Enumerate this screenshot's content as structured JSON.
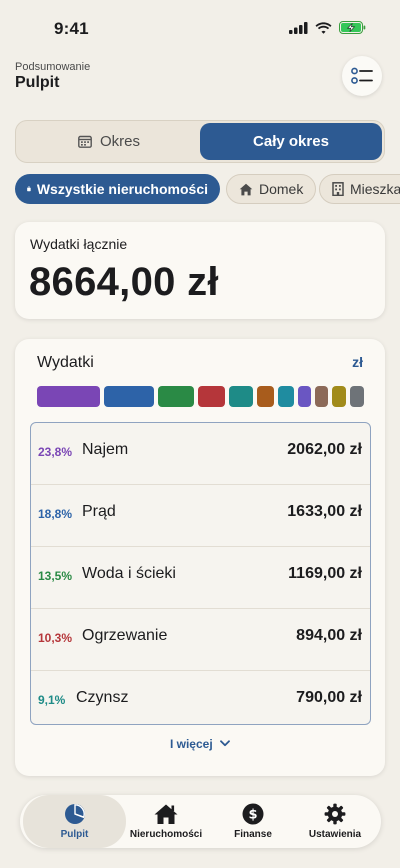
{
  "status_bar": {
    "time": "9:41"
  },
  "header": {
    "subtitle": "Podsumowanie",
    "title": "Pulpit"
  },
  "period_toggle": {
    "options": [
      "Okres",
      "Cały okres"
    ],
    "selected": "Cały okres"
  },
  "property_filter": {
    "chips": [
      "Wszystkie nieruchomości",
      "Domek",
      "Mieszkanie"
    ],
    "selected": "Wszystkie nieruchomości"
  },
  "total_card": {
    "label": "Wydatki łącznie",
    "amount": "8664,00 zł"
  },
  "expenses": {
    "title": "Wydatki",
    "currency": "zł",
    "segment_colors": [
      "#7a46b5",
      "#2d63a8",
      "#2a8a45",
      "#b5363a",
      "#1e8b87",
      "#a85c1c",
      "#1f8ca0",
      "#6a56c2",
      "#8c6a58",
      "#a18b1a",
      "#6e7378"
    ],
    "items": [
      {
        "pct": "23,8%",
        "name": "Najem",
        "amount": "2062,00 zł",
        "color": "#7a46b5"
      },
      {
        "pct": "18,8%",
        "name": "Prąd",
        "amount": "1633,00 zł",
        "color": "#2d63a8"
      },
      {
        "pct": "13,5%",
        "name": "Woda i ścieki",
        "amount": "1169,00 zł",
        "color": "#2a8a45"
      },
      {
        "pct": "10,3%",
        "name": "Ogrzewanie",
        "amount": "894,00 zł",
        "color": "#b5363a"
      },
      {
        "pct": "9,1%",
        "name": "Czynsz",
        "amount": "790,00 zł",
        "color": "#1e8b87"
      }
    ],
    "more_label": "I więcej"
  },
  "tab_bar": {
    "tabs": [
      "Pulpit",
      "Nieruchomości",
      "Finanse",
      "Ustawienia"
    ],
    "active": "Pulpit"
  }
}
